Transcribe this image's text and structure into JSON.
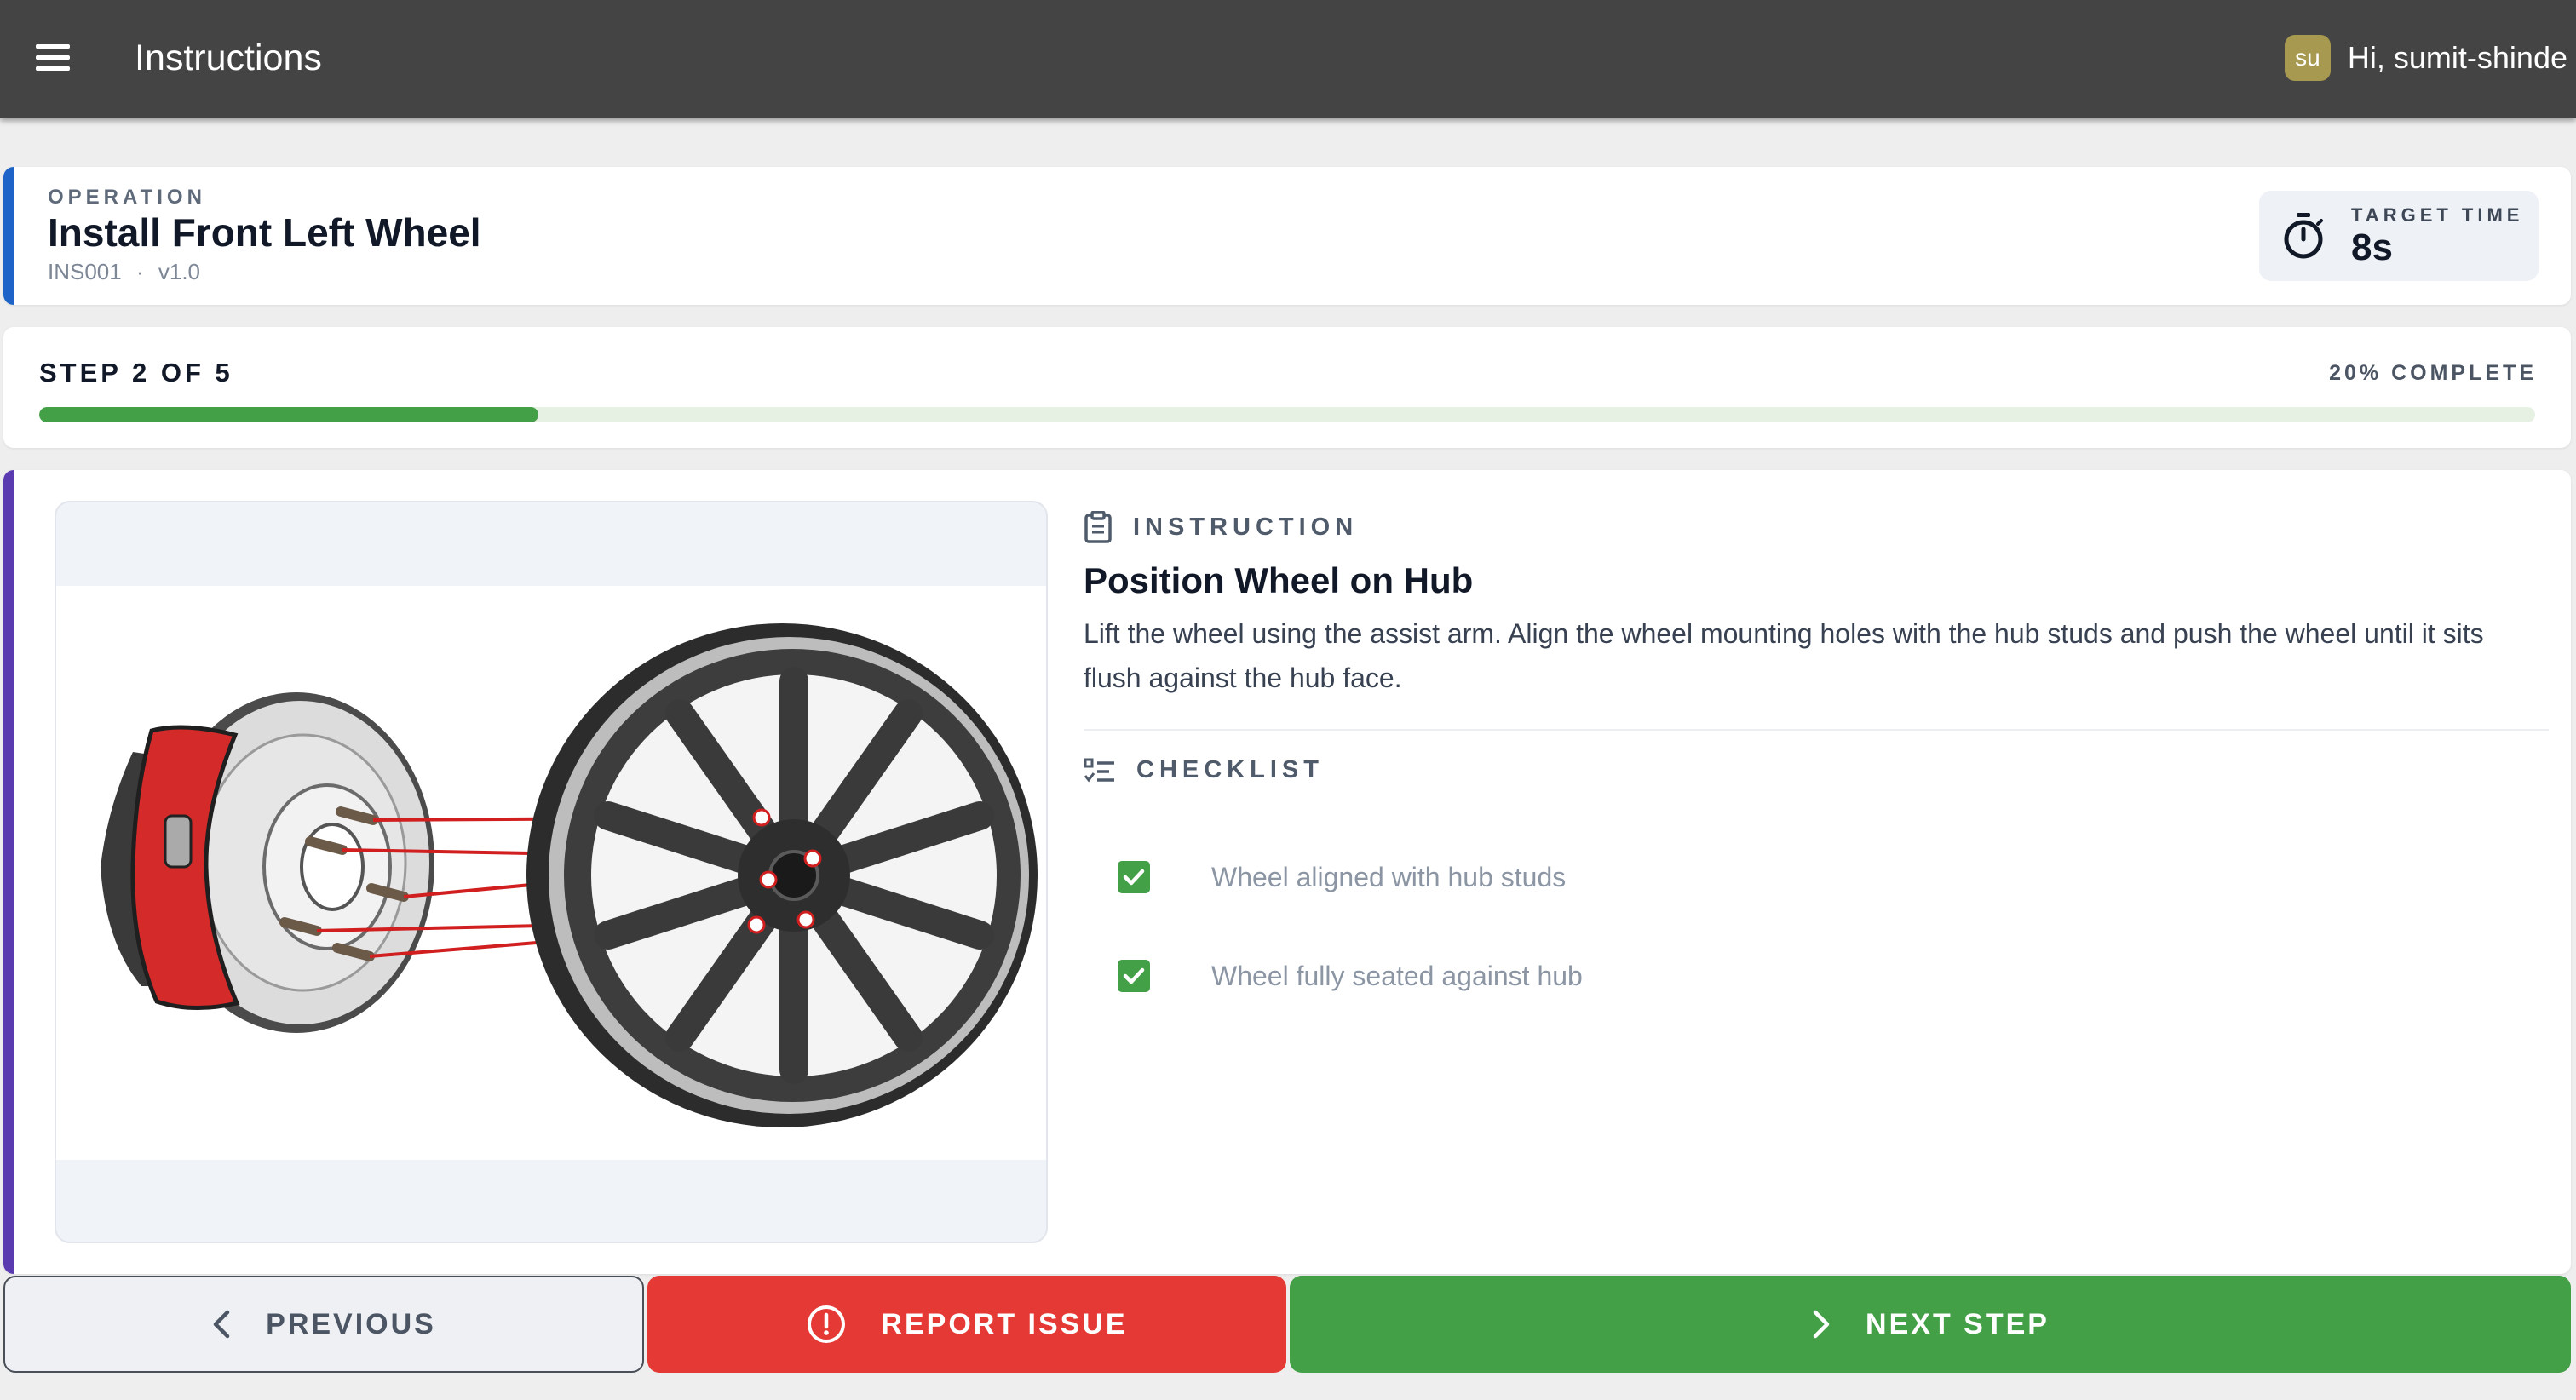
{
  "app_bar": {
    "title": "Instructions",
    "user_initials": "su",
    "greeting": "Hi, sumit-shinde"
  },
  "operation": {
    "label": "OPERATION",
    "title": "Install Front Left Wheel",
    "code": "INS001",
    "separator": "·",
    "version": "v1.0",
    "target_label": "TARGET TIME",
    "target_value": "8s"
  },
  "progress": {
    "step_label": "STEP 2 OF 5",
    "percent_label": "20% COMPLETE",
    "percent": 20
  },
  "instruction": {
    "section_label": "INSTRUCTION",
    "title": "Position Wheel on Hub",
    "description": "Lift the wheel using the assist arm. Align the wheel mounting holes with the hub studs and push the wheel until it sits flush against the hub face."
  },
  "checklist": {
    "section_label": "CHECKLIST",
    "items": [
      {
        "label": "Wheel aligned with hub studs",
        "checked": true
      },
      {
        "label": "Wheel fully seated against hub",
        "checked": true
      }
    ]
  },
  "buttons": {
    "previous": "PREVIOUS",
    "report": "REPORT ISSUE",
    "next": "NEXT STEP"
  },
  "colors": {
    "app_bar": "#444444",
    "operation_accent": "#1e63c8",
    "step_accent": "#5b3bb0",
    "success": "#43a047",
    "danger": "#e53935",
    "avatar": "#a89950"
  },
  "icons": {
    "menu": "menu-icon",
    "timer": "timer-icon",
    "instruction": "clipboard-icon",
    "checklist": "checklist-icon",
    "check": "check-icon",
    "previous": "chevron-left-icon",
    "report": "alert-circle-icon",
    "next": "chevron-right-icon"
  }
}
